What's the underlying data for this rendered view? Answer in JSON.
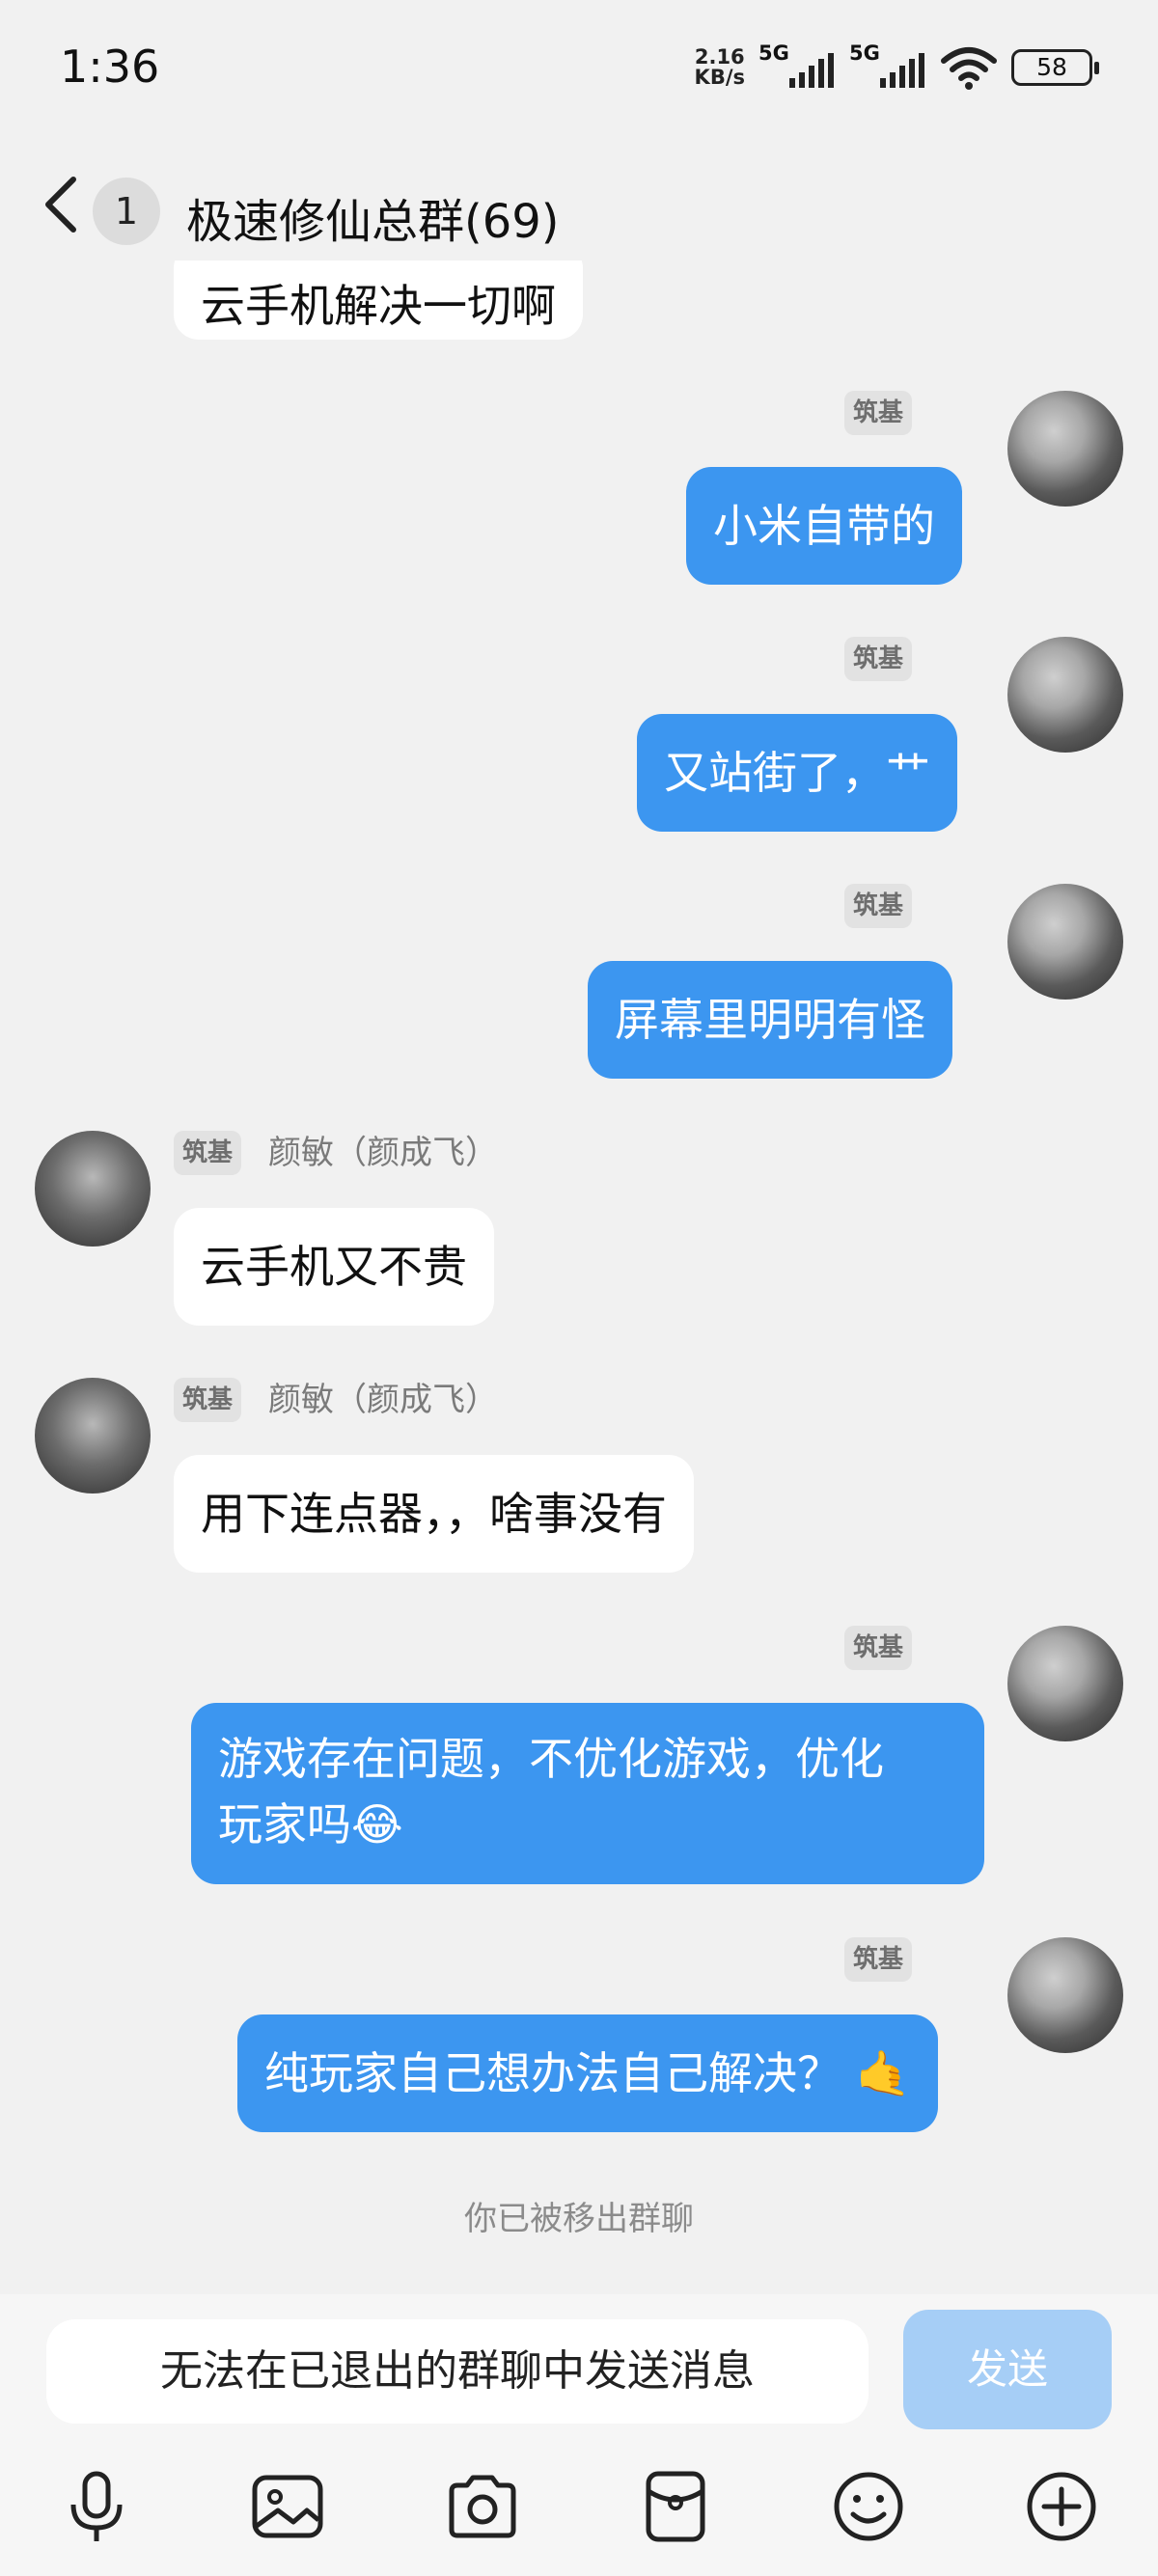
{
  "status": {
    "time": "1:36",
    "speed_value": "2.16",
    "speed_unit": "KB/s",
    "net1": "5G",
    "net2": "5G",
    "battery": "58"
  },
  "header": {
    "unread": "1",
    "title": "极速修仙总群(69)"
  },
  "messages": [
    {
      "text": "云手机解决一切啊"
    },
    {
      "tag": "筑基",
      "text": "小米自带的"
    },
    {
      "tag": "筑基",
      "text": "又站街了，艹"
    },
    {
      "tag": "筑基",
      "text": "屏幕里明明有怪"
    },
    {
      "tag": "筑基",
      "nick": "颜敏（颜成飞）",
      "text": "云手机又不贵"
    },
    {
      "tag": "筑基",
      "nick": "颜敏（颜成飞）",
      "text": "用下连点器，，啥事没有"
    },
    {
      "tag": "筑基",
      "line1": "游戏存在问题，不优化游戏，优化",
      "line2": "玩家吗😂"
    },
    {
      "tag": "筑基",
      "text": "纯玩家自己想办法自己解决？ 🤙"
    }
  ],
  "system_notice": "你已被移出群聊",
  "input": {
    "placeholder": "无法在已退出的群聊中发送消息",
    "send_label": "发送"
  },
  "toolbar": [
    "microphone-icon",
    "image-icon",
    "camera-icon",
    "red-packet-icon",
    "emoji-icon",
    "plus-icon"
  ],
  "colors": {
    "outgoing_bubble": "#3c96f0",
    "incoming_bubble": "#ffffff",
    "send_button_disabled": "#a6cef6"
  }
}
